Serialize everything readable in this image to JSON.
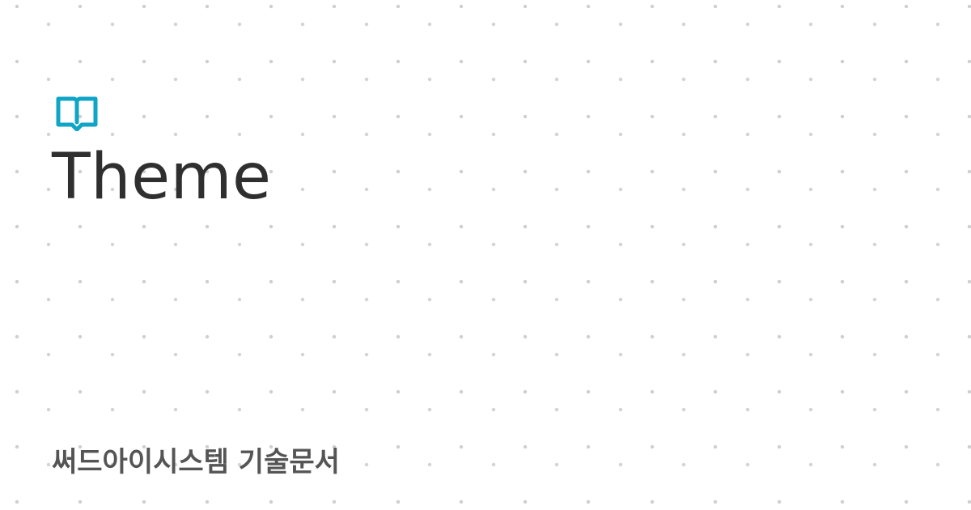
{
  "icon": {
    "name": "open-book-icon",
    "color": "#0ea5c6"
  },
  "title": "Theme",
  "subtitle": "써드아이시스템 기술문서",
  "colors": {
    "background": "#ffffff",
    "pattern": "#d0d0d0",
    "title": "#2f2f2f",
    "subtitle": "#555555"
  }
}
